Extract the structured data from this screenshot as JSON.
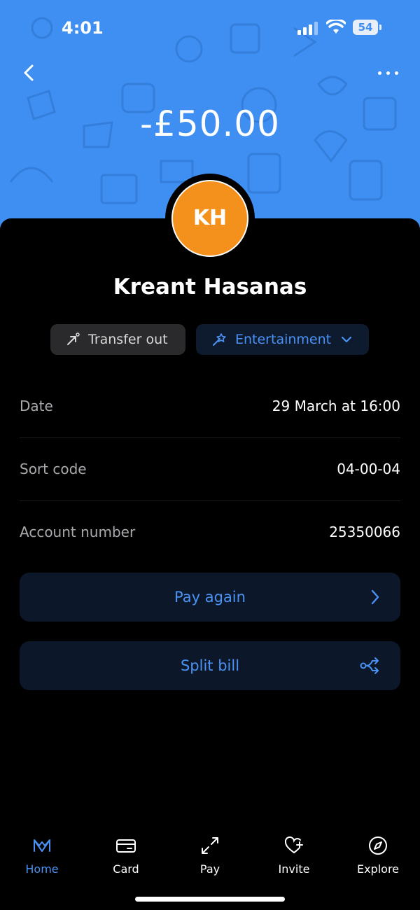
{
  "status_bar": {
    "time": "4:01",
    "battery": "54"
  },
  "transaction": {
    "amount": "-£50.00",
    "initials": "KH",
    "payee": "Kreant Hasanas",
    "type_chip": "Transfer out",
    "category_chip": "Entertainment"
  },
  "details": [
    {
      "label": "Date",
      "value": "29 March at 16:00"
    },
    {
      "label": "Sort code",
      "value": "04-00-04"
    },
    {
      "label": "Account number",
      "value": "25350066"
    }
  ],
  "actions": {
    "pay_again": "Pay again",
    "split_bill": "Split bill"
  },
  "tabs": [
    {
      "label": "Home",
      "icon": "monzo-logo-icon",
      "active": true
    },
    {
      "label": "Card",
      "icon": "card-icon",
      "active": false
    },
    {
      "label": "Pay",
      "icon": "transfer-arrows-icon",
      "active": false
    },
    {
      "label": "Invite",
      "icon": "heart-plus-icon",
      "active": false
    },
    {
      "label": "Explore",
      "icon": "compass-icon",
      "active": false
    }
  ],
  "colors": {
    "hero_blue": "#3f8ff3",
    "avatar_orange": "#f4901c",
    "accent_blue": "#4a93f5",
    "background": "#000000"
  }
}
